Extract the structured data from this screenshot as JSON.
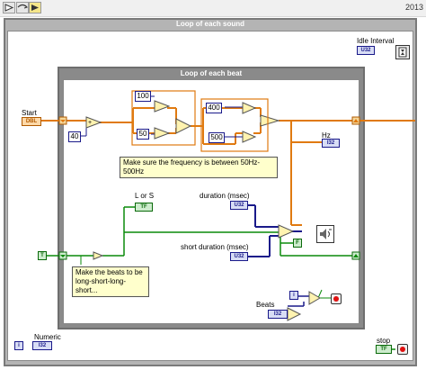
{
  "window": {
    "year": "2013"
  },
  "outer_loop": {
    "title": "Loop of each sound"
  },
  "inner_loop": {
    "title": "Loop of each beat"
  },
  "labels": {
    "start": "Start",
    "idle_interval": "Idle Interval",
    "hz": "Hz",
    "l_or_s": "L or S",
    "duration": "duration (msec)",
    "short_duration": "short duration (msec)",
    "beats": "Beats",
    "numeric": "Numeric",
    "stop": "stop"
  },
  "constants": {
    "c40": "40",
    "c100": "100",
    "c50": "50",
    "c400": "400",
    "c500": "500"
  },
  "comments": {
    "frequency": "Make sure the frequency is between 50Hz-500Hz",
    "beats": "Make the beats to be long-short-long-short..."
  },
  "terminals": {
    "dbl": "DBL",
    "i32": "I32",
    "u32": "U32",
    "tf": "TF",
    "i": "i",
    "t": "T",
    "f": "F"
  },
  "colors": {
    "orange": "#e07a10",
    "blue": "#1a1a8a",
    "green": "#0a8a0a",
    "frame": "#8a8a8a"
  }
}
